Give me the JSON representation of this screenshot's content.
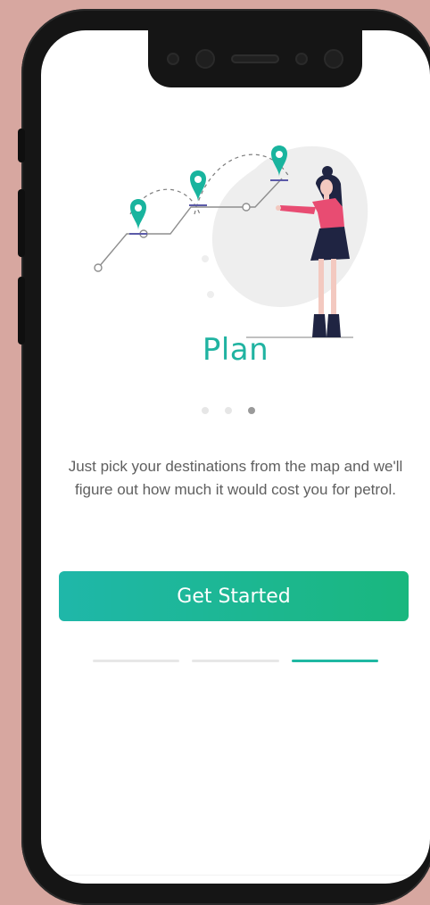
{
  "onboarding": {
    "title": "Plan",
    "description": "Just pick your destinations from the map and we'll figure out how much it would cost you for petrol.",
    "cta_label": "Get Started",
    "page_dots": {
      "total": 3,
      "active_index": 2
    },
    "progress_segments": {
      "total": 3,
      "active_index": 2
    }
  },
  "colors": {
    "accent": "#20b3a1",
    "button_gradient_start": "#1fb7a9",
    "button_gradient_end": "#1ab77e",
    "background": "#d7a7a0",
    "illustration_pink": "#e84c72",
    "illustration_navy": "#1f2442"
  },
  "icons": {
    "pins": [
      "map-pin-icon",
      "map-pin-icon",
      "map-pin-icon"
    ],
    "character": "person-illustration"
  }
}
